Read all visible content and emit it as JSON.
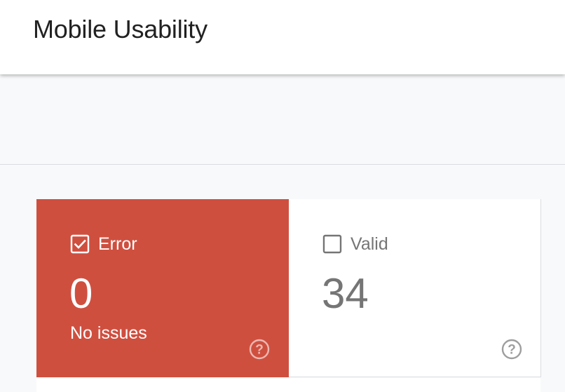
{
  "header": {
    "title": "Mobile Usability"
  },
  "cards": [
    {
      "label": "Error",
      "checked": true,
      "count": "0",
      "subtext": "No issues",
      "help_icon": "help-circle-icon",
      "color": "#cf4f3f"
    },
    {
      "label": "Valid",
      "checked": false,
      "count": "34",
      "subtext": "",
      "help_icon": "help-circle-icon",
      "color": "#ffffff"
    }
  ]
}
